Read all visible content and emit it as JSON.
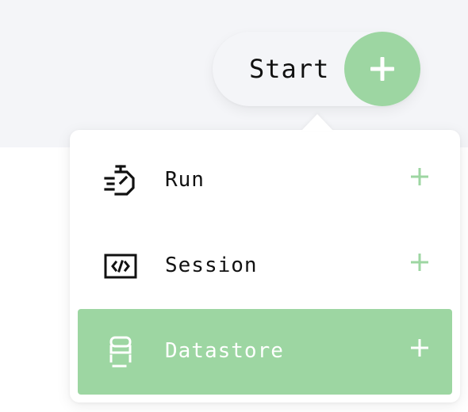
{
  "start_button": {
    "label": "Start",
    "icon": "plus-icon"
  },
  "menu": {
    "items": [
      {
        "label": "Run",
        "icon": "stopwatch-icon",
        "add_icon": "plus-icon",
        "active": false
      },
      {
        "label": "Session",
        "icon": "code-window-icon",
        "add_icon": "plus-icon",
        "active": false
      },
      {
        "label": "Datastore",
        "icon": "database-icon",
        "add_icon": "plus-icon",
        "active": true
      }
    ]
  },
  "colors": {
    "accent": "#9dd6a2",
    "background_band": "#f4f5f8",
    "text": "#111111",
    "active_text": "#ffffff"
  }
}
